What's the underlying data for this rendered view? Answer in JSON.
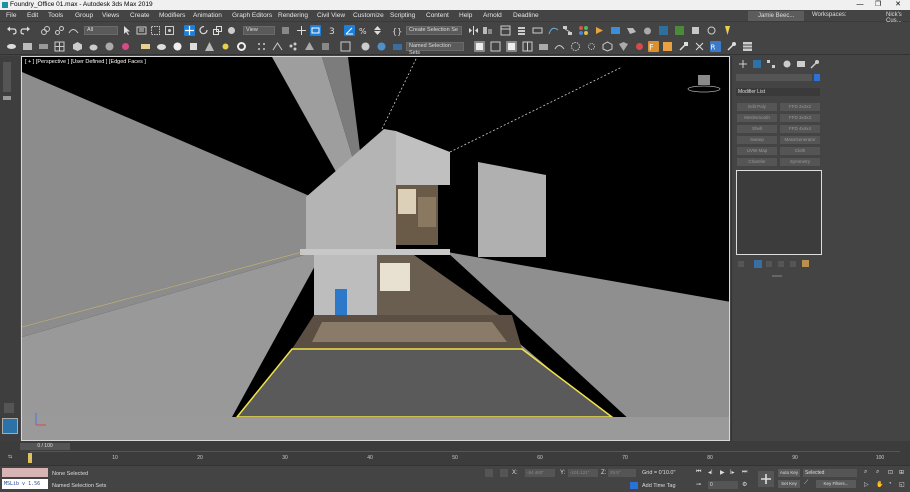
{
  "window": {
    "title": "Foundry_Office 01.max - Autodesk 3ds Max 2019",
    "minimize": "—",
    "maximize": "❐",
    "close": "✕"
  },
  "menu": [
    "File",
    "Edit",
    "Tools",
    "Group",
    "Views",
    "Create",
    "Modifiers",
    "Animation",
    "Graph Editors",
    "Rendering",
    "Civil View",
    "Customize",
    "Scripting",
    "Content",
    "Help",
    "Arnold",
    "Deadline"
  ],
  "user": {
    "name": "Jamie Beec...",
    "workspaces_label": "Workspaces:",
    "workspace_value": "Nick's Cus..."
  },
  "toolbar": {
    "selection_filter": "All",
    "ref_coord": "View",
    "create_selection_set": "Create Selection Se",
    "named_selection_sets": "Named Selection Sets"
  },
  "viewport": {
    "label": "[ + ] [Perspective ] [User Defined ] [Edged Faces ]"
  },
  "command_panel": {
    "modifier_list": "Modifier List",
    "buttons": [
      "Edit Poly",
      "FFD 2x2x2",
      "Meshsmooth",
      "FFD 3x3x3",
      "Shell",
      "FFD 4x4x4",
      "Sweep",
      "MassGenerator",
      "UVW Map",
      "Cloth",
      "Chamfer",
      "Symmetry"
    ]
  },
  "timeline": {
    "frame_counter": "0 / 100",
    "ticks": [
      "0",
      "10",
      "20",
      "30",
      "40",
      "50",
      "60",
      "70",
      "80",
      "90",
      "100"
    ]
  },
  "status": {
    "maxscript": "MSLib v 1.56",
    "selection": "None Selected",
    "named_sets": "Named Selection Sets",
    "x_label": "X:",
    "y_label": "Y:",
    "z_label": "Z:",
    "x_value": "-84.460\"",
    "y_value": "-101.121\"",
    "z_value": "29.5\"",
    "grid": "Grid = 0'10.0\"",
    "add_time_tag": "Add Time Tag",
    "auto_key": "Auto Key",
    "set_key": "Set Key",
    "selected": "Selected",
    "key_filters": "Key Filters...",
    "frame": "0"
  },
  "colors": {
    "accent": "#1e7fd8",
    "selection_yellow": "#f0e24a",
    "viewport_border": "#d8d8d8"
  }
}
